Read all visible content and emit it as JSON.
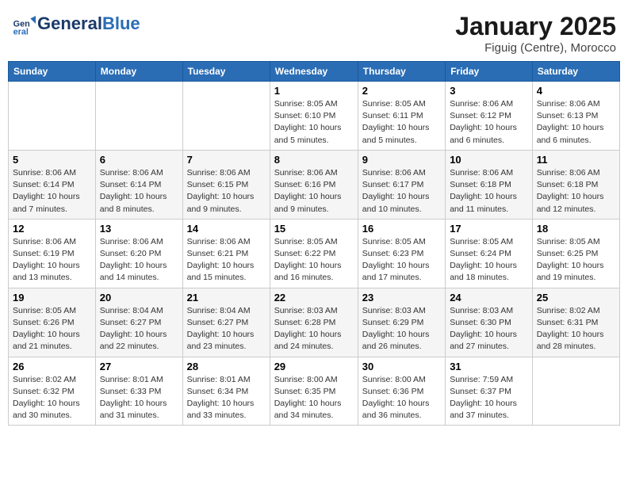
{
  "logo": {
    "general": "General",
    "blue": "Blue"
  },
  "title": "January 2025",
  "subtitle": "Figuig (Centre), Morocco",
  "days_of_week": [
    "Sunday",
    "Monday",
    "Tuesday",
    "Wednesday",
    "Thursday",
    "Friday",
    "Saturday"
  ],
  "weeks": [
    [
      {
        "day": "",
        "info": ""
      },
      {
        "day": "",
        "info": ""
      },
      {
        "day": "",
        "info": ""
      },
      {
        "day": "1",
        "info": "Sunrise: 8:05 AM\nSunset: 6:10 PM\nDaylight: 10 hours\nand 5 minutes."
      },
      {
        "day": "2",
        "info": "Sunrise: 8:05 AM\nSunset: 6:11 PM\nDaylight: 10 hours\nand 5 minutes."
      },
      {
        "day": "3",
        "info": "Sunrise: 8:06 AM\nSunset: 6:12 PM\nDaylight: 10 hours\nand 6 minutes."
      },
      {
        "day": "4",
        "info": "Sunrise: 8:06 AM\nSunset: 6:13 PM\nDaylight: 10 hours\nand 6 minutes."
      }
    ],
    [
      {
        "day": "5",
        "info": "Sunrise: 8:06 AM\nSunset: 6:14 PM\nDaylight: 10 hours\nand 7 minutes."
      },
      {
        "day": "6",
        "info": "Sunrise: 8:06 AM\nSunset: 6:14 PM\nDaylight: 10 hours\nand 8 minutes."
      },
      {
        "day": "7",
        "info": "Sunrise: 8:06 AM\nSunset: 6:15 PM\nDaylight: 10 hours\nand 9 minutes."
      },
      {
        "day": "8",
        "info": "Sunrise: 8:06 AM\nSunset: 6:16 PM\nDaylight: 10 hours\nand 9 minutes."
      },
      {
        "day": "9",
        "info": "Sunrise: 8:06 AM\nSunset: 6:17 PM\nDaylight: 10 hours\nand 10 minutes."
      },
      {
        "day": "10",
        "info": "Sunrise: 8:06 AM\nSunset: 6:18 PM\nDaylight: 10 hours\nand 11 minutes."
      },
      {
        "day": "11",
        "info": "Sunrise: 8:06 AM\nSunset: 6:18 PM\nDaylight: 10 hours\nand 12 minutes."
      }
    ],
    [
      {
        "day": "12",
        "info": "Sunrise: 8:06 AM\nSunset: 6:19 PM\nDaylight: 10 hours\nand 13 minutes."
      },
      {
        "day": "13",
        "info": "Sunrise: 8:06 AM\nSunset: 6:20 PM\nDaylight: 10 hours\nand 14 minutes."
      },
      {
        "day": "14",
        "info": "Sunrise: 8:06 AM\nSunset: 6:21 PM\nDaylight: 10 hours\nand 15 minutes."
      },
      {
        "day": "15",
        "info": "Sunrise: 8:05 AM\nSunset: 6:22 PM\nDaylight: 10 hours\nand 16 minutes."
      },
      {
        "day": "16",
        "info": "Sunrise: 8:05 AM\nSunset: 6:23 PM\nDaylight: 10 hours\nand 17 minutes."
      },
      {
        "day": "17",
        "info": "Sunrise: 8:05 AM\nSunset: 6:24 PM\nDaylight: 10 hours\nand 18 minutes."
      },
      {
        "day": "18",
        "info": "Sunrise: 8:05 AM\nSunset: 6:25 PM\nDaylight: 10 hours\nand 19 minutes."
      }
    ],
    [
      {
        "day": "19",
        "info": "Sunrise: 8:05 AM\nSunset: 6:26 PM\nDaylight: 10 hours\nand 21 minutes."
      },
      {
        "day": "20",
        "info": "Sunrise: 8:04 AM\nSunset: 6:27 PM\nDaylight: 10 hours\nand 22 minutes."
      },
      {
        "day": "21",
        "info": "Sunrise: 8:04 AM\nSunset: 6:27 PM\nDaylight: 10 hours\nand 23 minutes."
      },
      {
        "day": "22",
        "info": "Sunrise: 8:03 AM\nSunset: 6:28 PM\nDaylight: 10 hours\nand 24 minutes."
      },
      {
        "day": "23",
        "info": "Sunrise: 8:03 AM\nSunset: 6:29 PM\nDaylight: 10 hours\nand 26 minutes."
      },
      {
        "day": "24",
        "info": "Sunrise: 8:03 AM\nSunset: 6:30 PM\nDaylight: 10 hours\nand 27 minutes."
      },
      {
        "day": "25",
        "info": "Sunrise: 8:02 AM\nSunset: 6:31 PM\nDaylight: 10 hours\nand 28 minutes."
      }
    ],
    [
      {
        "day": "26",
        "info": "Sunrise: 8:02 AM\nSunset: 6:32 PM\nDaylight: 10 hours\nand 30 minutes."
      },
      {
        "day": "27",
        "info": "Sunrise: 8:01 AM\nSunset: 6:33 PM\nDaylight: 10 hours\nand 31 minutes."
      },
      {
        "day": "28",
        "info": "Sunrise: 8:01 AM\nSunset: 6:34 PM\nDaylight: 10 hours\nand 33 minutes."
      },
      {
        "day": "29",
        "info": "Sunrise: 8:00 AM\nSunset: 6:35 PM\nDaylight: 10 hours\nand 34 minutes."
      },
      {
        "day": "30",
        "info": "Sunrise: 8:00 AM\nSunset: 6:36 PM\nDaylight: 10 hours\nand 36 minutes."
      },
      {
        "day": "31",
        "info": "Sunrise: 7:59 AM\nSunset: 6:37 PM\nDaylight: 10 hours\nand 37 minutes."
      },
      {
        "day": "",
        "info": ""
      }
    ]
  ]
}
